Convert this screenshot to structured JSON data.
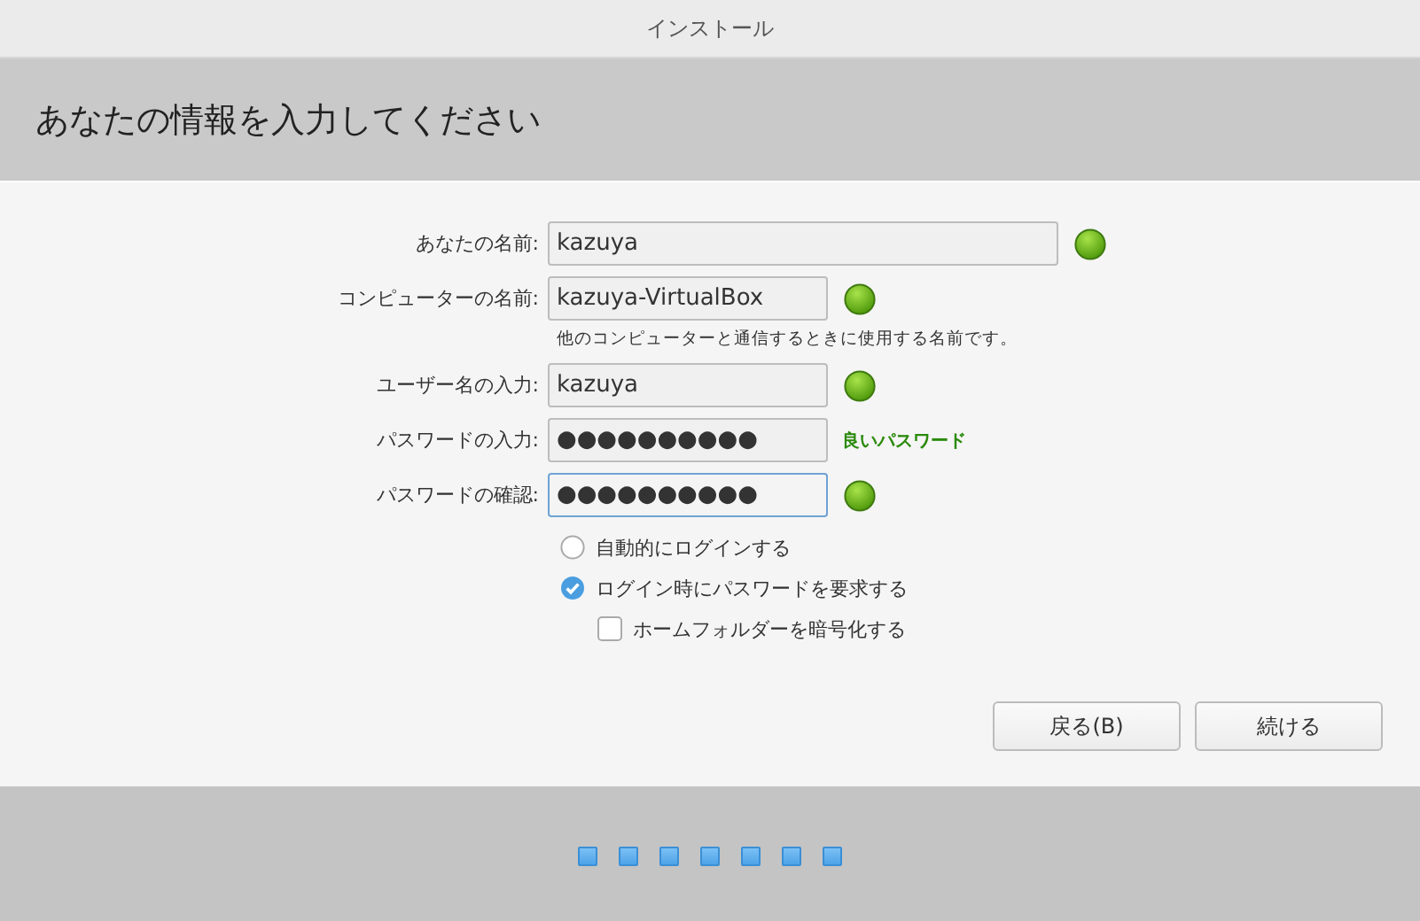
{
  "window": {
    "title": "インストール"
  },
  "header": {
    "title": "あなたの情報を入力してください"
  },
  "fields": [
    {
      "label": "あなたの名前:",
      "value": "kazuya",
      "wide": true,
      "valid": true,
      "focused": false
    },
    {
      "label": "コンピューターの名前:",
      "value": "kazuya-VirtualBox",
      "wide": false,
      "valid": true,
      "focused": false,
      "hint": "他のコンピューターと通信するときに使用する名前です。"
    },
    {
      "label": "ユーザー名の入力:",
      "value": "kazuya",
      "wide": false,
      "valid": true,
      "focused": false
    },
    {
      "label": "パスワードの入力:",
      "value": "●●●●●●●●●●",
      "wide": false,
      "valid": false,
      "focused": false,
      "strength": "良いパスワード"
    },
    {
      "label": "パスワードの確認:",
      "value": "●●●●●●●●●●",
      "wide": false,
      "valid": true,
      "focused": true
    }
  ],
  "options": [
    {
      "kind": "radio",
      "label": "自動的にログインする",
      "checked": false
    },
    {
      "kind": "radio",
      "label": "ログイン時にパスワードを要求する",
      "checked": true,
      "children": [
        {
          "kind": "checkbox",
          "label": "ホームフォルダーを暗号化する",
          "checked": false
        }
      ]
    }
  ],
  "buttons": [
    "戻る(B)",
    "続ける"
  ]
}
